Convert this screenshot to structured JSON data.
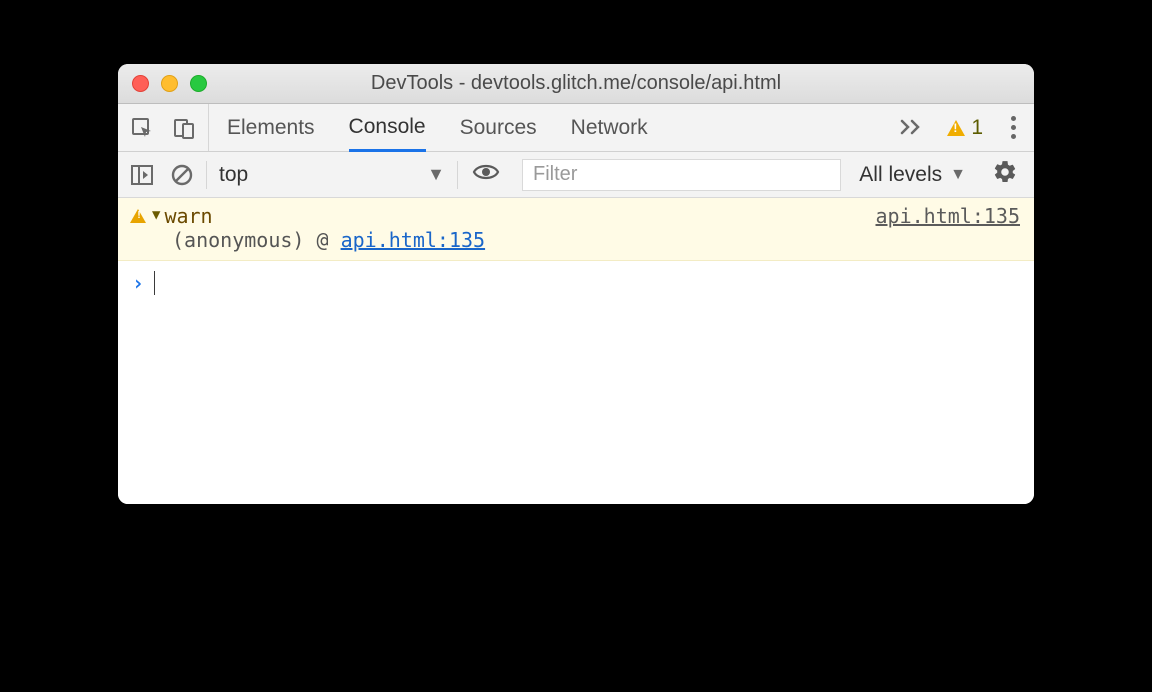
{
  "window": {
    "title": "DevTools - devtools.glitch.me/console/api.html"
  },
  "tabs": {
    "items": [
      "Elements",
      "Console",
      "Sources",
      "Network"
    ],
    "active_index": 1,
    "warning_count": "1"
  },
  "toolbar": {
    "context": "top",
    "filter_placeholder": "Filter",
    "levels_label": "All levels"
  },
  "console": {
    "warn": {
      "label": "warn",
      "source_link": "api.html:135",
      "stack_prefix": "(anonymous) @ ",
      "stack_link": "api.html:135"
    }
  }
}
